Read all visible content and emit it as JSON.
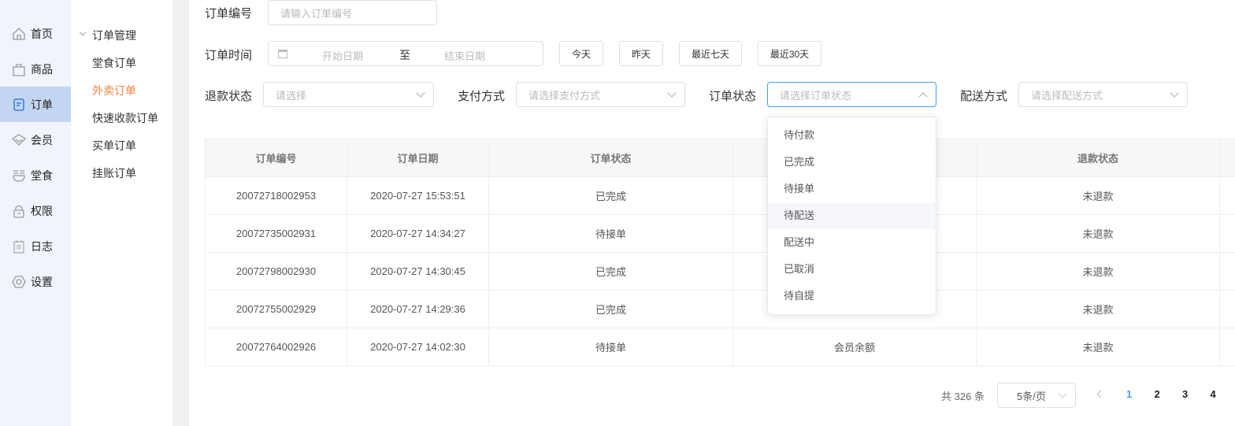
{
  "nav": [
    {
      "label": "首页",
      "icon": "home-icon"
    },
    {
      "label": "商品",
      "icon": "bag-icon"
    },
    {
      "label": "订单",
      "icon": "order-icon",
      "active": true
    },
    {
      "label": "会员",
      "icon": "diamond-icon"
    },
    {
      "label": "堂食",
      "icon": "bowl-icon"
    },
    {
      "label": "权限",
      "icon": "lock-icon"
    },
    {
      "label": "日志",
      "icon": "log-icon"
    },
    {
      "label": "设置",
      "icon": "settings-icon"
    }
  ],
  "submenu": {
    "group": "订单管理",
    "items": [
      "堂食订单",
      "外卖订单",
      "快速收款订单",
      "买单订单",
      "挂账订单"
    ],
    "active_index": 1,
    "active_color": "#f5803e"
  },
  "filters": {
    "order_no": {
      "label": "订单编号",
      "placeholder": "请输入订单编号"
    },
    "order_time": {
      "label": "订单时间",
      "start": "开始日期",
      "sep": "至",
      "end": "结束日期",
      "quick": [
        "今天",
        "昨天",
        "最近七天",
        "最近30天"
      ]
    },
    "refund": {
      "label": "退款状态",
      "placeholder": "请选择"
    },
    "pay": {
      "label": "支付方式",
      "placeholder": "请选择支付方式"
    },
    "status": {
      "label": "订单状态",
      "placeholder": "请选择订单状态"
    },
    "delivery": {
      "label": "配送方式",
      "placeholder": "请选择配送方式"
    }
  },
  "table": {
    "headers": [
      "订单编号",
      "订单日期",
      "订单状态",
      "",
      "退款状态",
      ""
    ],
    "rows": [
      [
        "20072718002953",
        "2020-07-27 15:53:51",
        "已完成",
        "",
        "未退款"
      ],
      [
        "20072735002931",
        "2020-07-27 14:34:27",
        "待接单",
        "",
        "未退款"
      ],
      [
        "20072798002930",
        "2020-07-27 14:30:45",
        "已完成",
        "",
        "未退款"
      ],
      [
        "20072755002929",
        "2020-07-27 14:29:36",
        "已完成",
        "",
        "未退款"
      ],
      [
        "20072764002926",
        "2020-07-27 14:02:30",
        "待接单",
        "会员余额",
        "未退款"
      ]
    ]
  },
  "dropdown": {
    "options": [
      "待付款",
      "已完成",
      "待接单",
      "待配送",
      "配送中",
      "已取消",
      "待自提"
    ],
    "hover_index": 3
  },
  "pagination": {
    "total": "共 326 条",
    "page_size": "5条/页",
    "pages": [
      "1",
      "2",
      "3",
      "4"
    ],
    "current": "1",
    "accent": "#409eff"
  }
}
